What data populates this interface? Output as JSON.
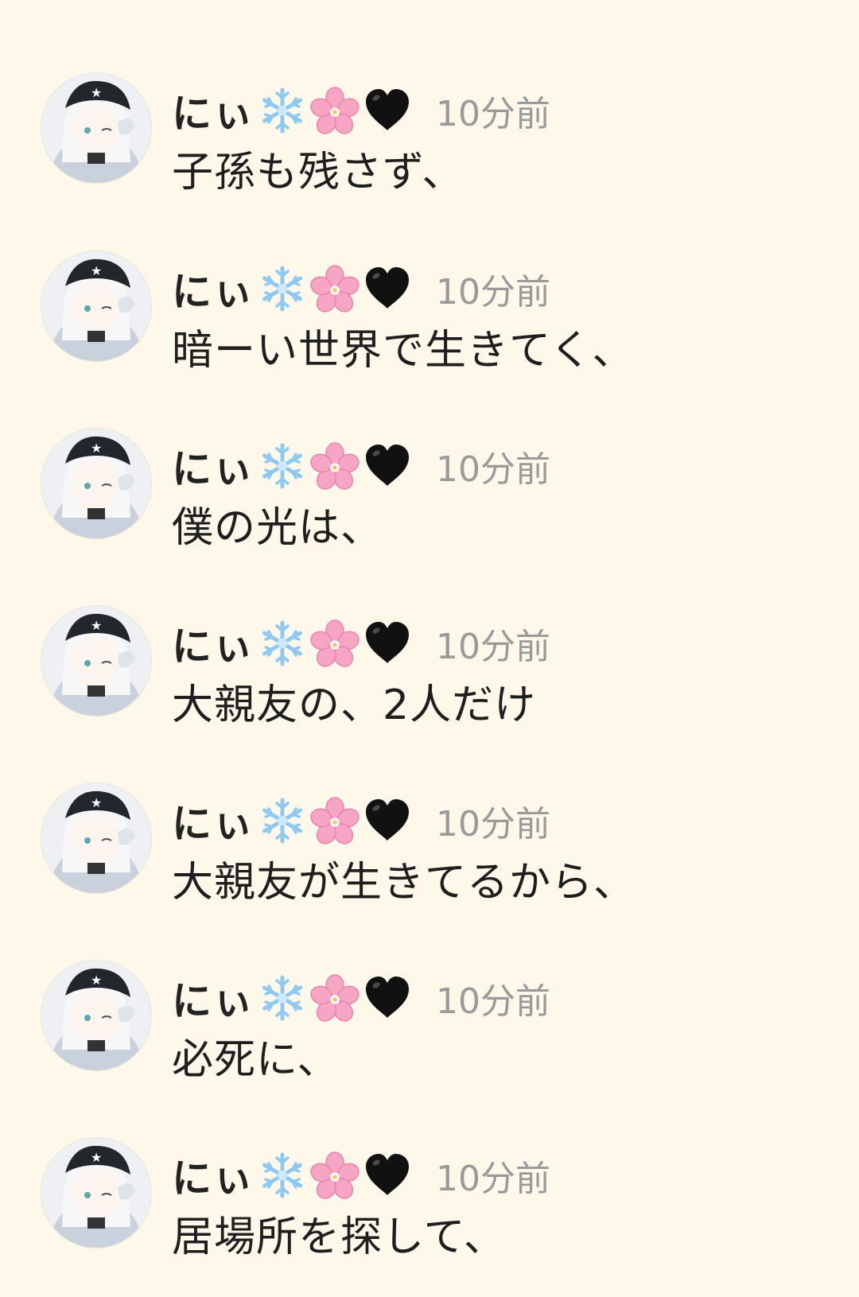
{
  "feed": {
    "posts": [
      {
        "username": "にぃ",
        "badges": [
          "snowflake-emoji",
          "cherry-blossom-emoji",
          "black-heart-emoji"
        ],
        "time": "10分前",
        "message": "子孫も残さず、"
      },
      {
        "username": "にぃ",
        "badges": [
          "snowflake-emoji",
          "cherry-blossom-emoji",
          "black-heart-emoji"
        ],
        "time": "10分前",
        "message": "暗ーい世界で生きてく、"
      },
      {
        "username": "にぃ",
        "badges": [
          "snowflake-emoji",
          "cherry-blossom-emoji",
          "black-heart-emoji"
        ],
        "time": "10分前",
        "message": "僕の光は、"
      },
      {
        "username": "にぃ",
        "badges": [
          "snowflake-emoji",
          "cherry-blossom-emoji",
          "black-heart-emoji"
        ],
        "time": "10分前",
        "message": "大親友の、2人だけ"
      },
      {
        "username": "にぃ",
        "badges": [
          "snowflake-emoji",
          "cherry-blossom-emoji",
          "black-heart-emoji"
        ],
        "time": "10分前",
        "message": "大親友が生きてるから、"
      },
      {
        "username": "にぃ",
        "badges": [
          "snowflake-emoji",
          "cherry-blossom-emoji",
          "black-heart-emoji"
        ],
        "time": "10分前",
        "message": "必死に、"
      },
      {
        "username": "にぃ",
        "badges": [
          "snowflake-emoji",
          "cherry-blossom-emoji",
          "black-heart-emoji"
        ],
        "time": "10分前",
        "message": "居場所を探して、"
      }
    ]
  },
  "colors": {
    "background": "#fdf8ea",
    "username": "#222222",
    "timestamp": "#9a9a9a",
    "message": "#1e1e1e",
    "snowflake": "#8ec9f2",
    "blossom": "#f6a6c4",
    "heart": "#111111"
  }
}
